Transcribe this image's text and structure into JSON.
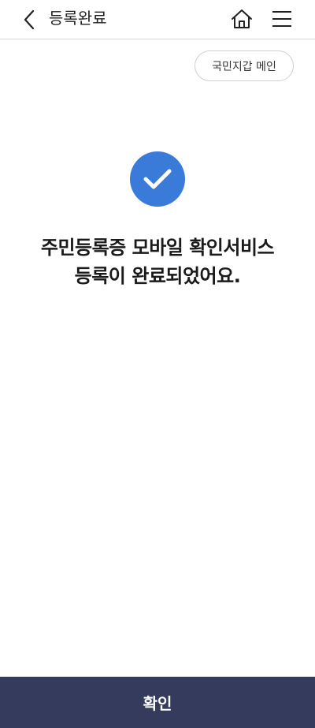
{
  "header": {
    "title": "등록완료",
    "back_icon": "chevron-left-icon",
    "home_icon": "home-icon",
    "menu_icon": "hamburger-menu-icon"
  },
  "wallet_main_button": {
    "label": "국민지갑 메인"
  },
  "status": {
    "icon": "check-circle-icon",
    "icon_color": "#3a7ad9",
    "message_line1": "주민등록증 모바일 확인서비스",
    "message_line2": "등록이 완료되었어요."
  },
  "footer": {
    "confirm_label": "확인",
    "confirm_color": "#353b5c"
  }
}
